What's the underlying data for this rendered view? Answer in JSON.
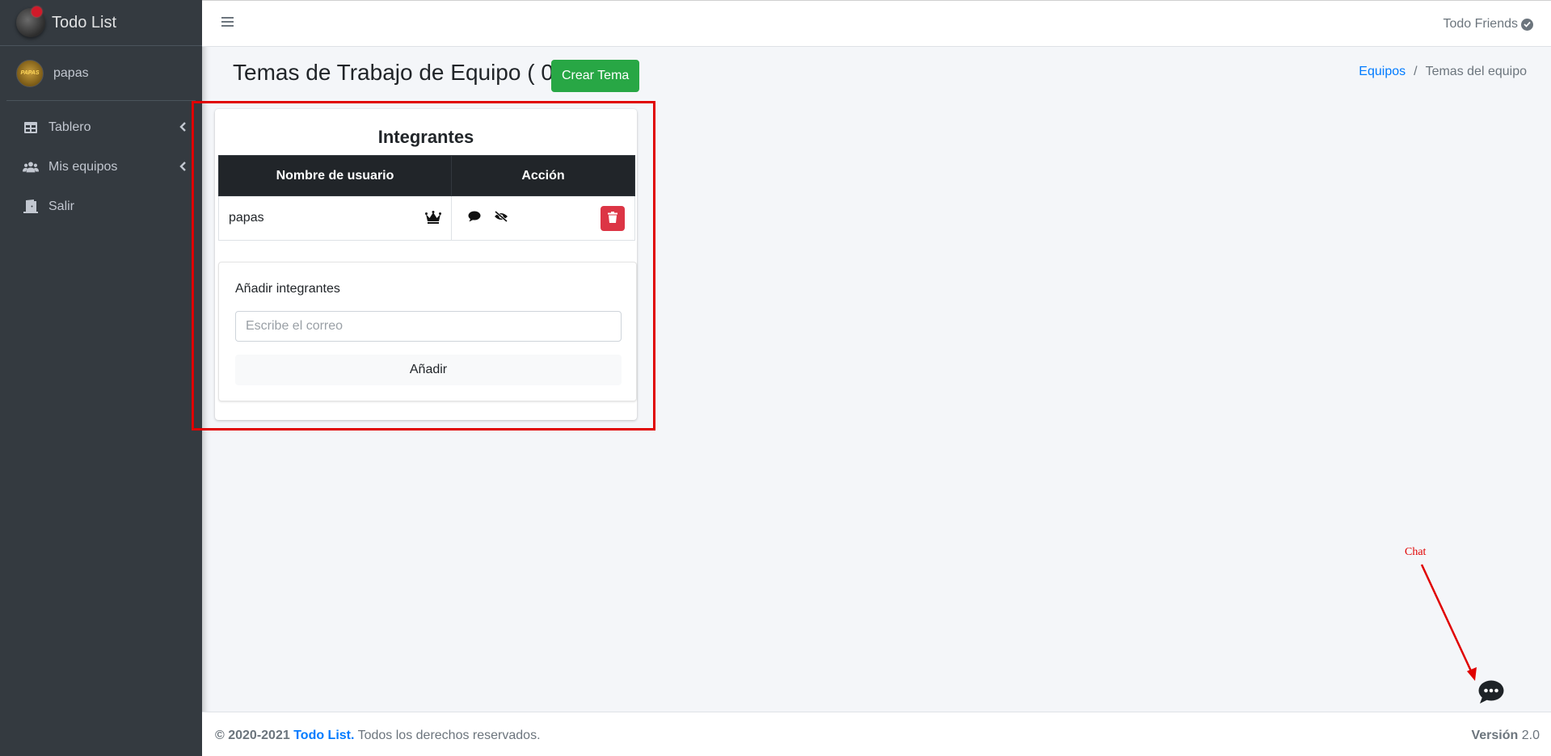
{
  "brand": {
    "name": "Todo List"
  },
  "user": {
    "name": "papas",
    "avatar_text": "PAPAS"
  },
  "sidebar": {
    "items": [
      {
        "label": "Tablero",
        "icon": "table-icon",
        "has_arrow": true
      },
      {
        "label": "Mis equipos",
        "icon": "users-icon",
        "has_arrow": true
      },
      {
        "label": "Salir",
        "icon": "door-open-icon",
        "has_arrow": false
      }
    ]
  },
  "topbar": {
    "right_label": "Todo Friends"
  },
  "header": {
    "title": "Temas de Trabajo de Equipo ( 0 )",
    "create_button": "Crear Tema",
    "breadcrumb": {
      "link": "Equipos",
      "separator": "/",
      "current": "Temas del equipo"
    }
  },
  "members_card": {
    "title": "Integrantes",
    "columns": [
      "Nombre de usuario",
      "Acción"
    ],
    "rows": [
      {
        "username": "papas",
        "is_owner": true
      }
    ],
    "add_section": {
      "label": "Añadir integrantes",
      "input_placeholder": "Escribe el correo",
      "input_value": "",
      "button": "Añadir"
    }
  },
  "annotation": {
    "text": "Chat",
    "color": "#e00000"
  },
  "footer": {
    "copyright": "© 2020-2021",
    "brand": "Todo List.",
    "rights": "Todos los derechos reservados.",
    "version_label": "Versión",
    "version_number": "2.0"
  },
  "colors": {
    "sidebar": "#343a40",
    "success": "#28a745",
    "danger": "#dc3545",
    "primary": "#007bff",
    "table_head": "#212529"
  }
}
